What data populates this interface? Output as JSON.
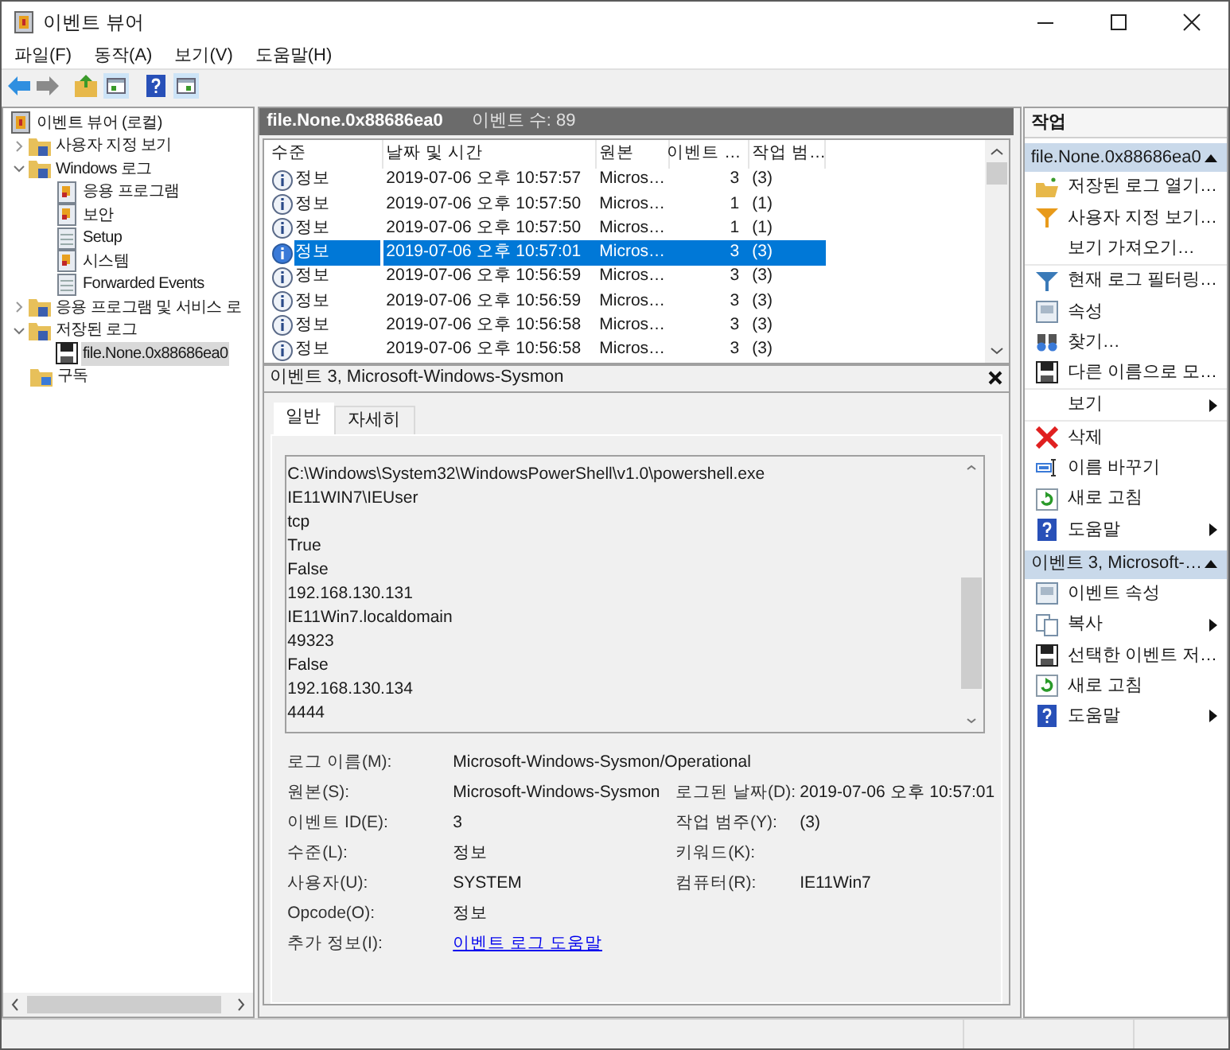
{
  "window": {
    "title": "이벤트 뷰어"
  },
  "menu": [
    "파일(F)",
    "동작(A)",
    "보기(V)",
    "도움말(H)"
  ],
  "tree": [
    {
      "label": "이벤트 뷰어 (로컬)",
      "kind": "root",
      "selected": false,
      "children": [
        {
          "label": "사용자 지정 보기",
          "kind": "folder",
          "selected": false,
          "expanded": false
        },
        {
          "label": "Windows 로그",
          "kind": "folder",
          "selected": false,
          "expanded": true,
          "children": [
            {
              "label": "응용 프로그램",
              "kind": "log",
              "selected": false
            },
            {
              "label": "보안",
              "kind": "log",
              "selected": false
            },
            {
              "label": "Setup",
              "kind": "plain-log",
              "selected": false
            },
            {
              "label": "시스템",
              "kind": "log",
              "selected": false
            },
            {
              "label": "Forwarded Events",
              "kind": "plain-log",
              "selected": false
            }
          ]
        },
        {
          "label": "응용 프로그램 및 서비스 로",
          "kind": "folder",
          "selected": false,
          "expanded": false
        },
        {
          "label": "저장된 로그",
          "kind": "folder",
          "selected": false,
          "expanded": true,
          "children": [
            {
              "label": "file.None.0x88686ea0",
              "kind": "file",
              "selected": true
            }
          ]
        },
        {
          "label": "구독",
          "kind": "subscription",
          "selected": false
        }
      ]
    }
  ],
  "log_header": {
    "title": "file.None.0x88686ea0",
    "count": "이벤트 수: 89"
  },
  "events": {
    "columns": [
      "수준",
      "날짜 및 시간",
      "원본",
      "이벤트 …",
      "작업 범…"
    ],
    "rows": [
      {
        "selected": false,
        "cells": [
          "정보",
          "2019-07-06 오후 10:57:57",
          "Micros…",
          "3",
          "(3)"
        ]
      },
      {
        "selected": false,
        "cells": [
          "정보",
          "2019-07-06 오후 10:57:50",
          "Micros…",
          "1",
          "(1)"
        ]
      },
      {
        "selected": false,
        "cells": [
          "정보",
          "2019-07-06 오후 10:57:50",
          "Micros…",
          "1",
          "(1)"
        ]
      },
      {
        "selected": true,
        "cells": [
          "정보",
          "2019-07-06 오후 10:57:01",
          "Micros…",
          "3",
          "(3)"
        ]
      },
      {
        "selected": false,
        "cells": [
          "정보",
          "2019-07-06 오후 10:56:59",
          "Micros…",
          "3",
          "(3)"
        ]
      },
      {
        "selected": false,
        "cells": [
          "정보",
          "2019-07-06 오후 10:56:59",
          "Micros…",
          "3",
          "(3)"
        ]
      },
      {
        "selected": false,
        "cells": [
          "정보",
          "2019-07-06 오후 10:56:58",
          "Micros…",
          "3",
          "(3)"
        ]
      },
      {
        "selected": false,
        "cells": [
          "정보",
          "2019-07-06 오후 10:56:58",
          "Micros…",
          "3",
          "(3)"
        ]
      }
    ]
  },
  "detail": {
    "title": "이벤트 3, Microsoft-Windows-Sysmon",
    "tabs": [
      {
        "label": "일반",
        "selected": true
      },
      {
        "label": "자세히",
        "selected": false
      }
    ],
    "description_lines": [
      "C:\\Windows\\System32\\WindowsPowerShell\\v1.0\\powershell.exe",
      "IE11WIN7\\IEUser",
      "tcp",
      "True",
      "False",
      "192.168.130.131",
      "IE11Win7.localdomain",
      "49323",
      "False",
      "192.168.130.134",
      "4444"
    ],
    "properties": [
      [
        {
          "label": "로그 이름(M):",
          "value": "Microsoft-Windows-Sysmon/Operational"
        }
      ],
      [
        {
          "label": "원본(S):",
          "value": "Microsoft-Windows-Sysmon"
        },
        {
          "label": "로그된 날짜(D):",
          "value": "2019-07-06 오후 10:57:01"
        }
      ],
      [
        {
          "label": "이벤트 ID(E):",
          "value": "3"
        },
        {
          "label": "작업 범주(Y):",
          "value": "(3)"
        }
      ],
      [
        {
          "label": "수준(L):",
          "value": "정보"
        },
        {
          "label": "키워드(K):"
        }
      ],
      [
        {
          "label": "사용자(U):",
          "value": "SYSTEM"
        },
        {
          "label": "컴퓨터(R):",
          "value": "IE11Win7"
        }
      ],
      [
        {
          "label": "Opcode(O):",
          "value": "정보"
        }
      ],
      [
        {
          "label": "추가 정보(I):",
          "value": "이벤트 로그 도움말",
          "kind": "link"
        }
      ]
    ]
  },
  "actions": {
    "title": "작업",
    "sections": [
      {
        "title": "file.None.0x88686ea0",
        "expanded": true,
        "groups": [
          [
            {
              "label": "저장된 로그 열기…",
              "submenu": false
            },
            {
              "label": "사용자 지정 보기…",
              "submenu": false
            },
            {
              "label": "보기 가져오기…",
              "submenu": false
            }
          ],
          [
            {
              "label": "현재 로그 필터링…",
              "submenu": false
            },
            {
              "label": "속성",
              "submenu": false
            },
            {
              "label": "찾기…",
              "submenu": false
            },
            {
              "label": "다른 이름으로 모…",
              "submenu": false
            }
          ],
          [
            {
              "label": "보기",
              "submenu": true
            }
          ],
          [
            {
              "label": "삭제",
              "submenu": false
            },
            {
              "label": "이름 바꾸기",
              "submenu": false
            },
            {
              "label": "새로 고침",
              "submenu": false
            },
            {
              "label": "도움말",
              "submenu": true
            }
          ]
        ]
      },
      {
        "title": "이벤트 3, Microsoft-…",
        "expanded": true,
        "groups": [
          [
            {
              "label": "이벤트 속성",
              "submenu": false
            },
            {
              "label": "복사",
              "submenu": true
            },
            {
              "label": "선택한 이벤트 저…",
              "submenu": false
            },
            {
              "label": "새로 고침",
              "submenu": false
            },
            {
              "label": "도움말",
              "submenu": true
            }
          ]
        ]
      }
    ]
  }
}
